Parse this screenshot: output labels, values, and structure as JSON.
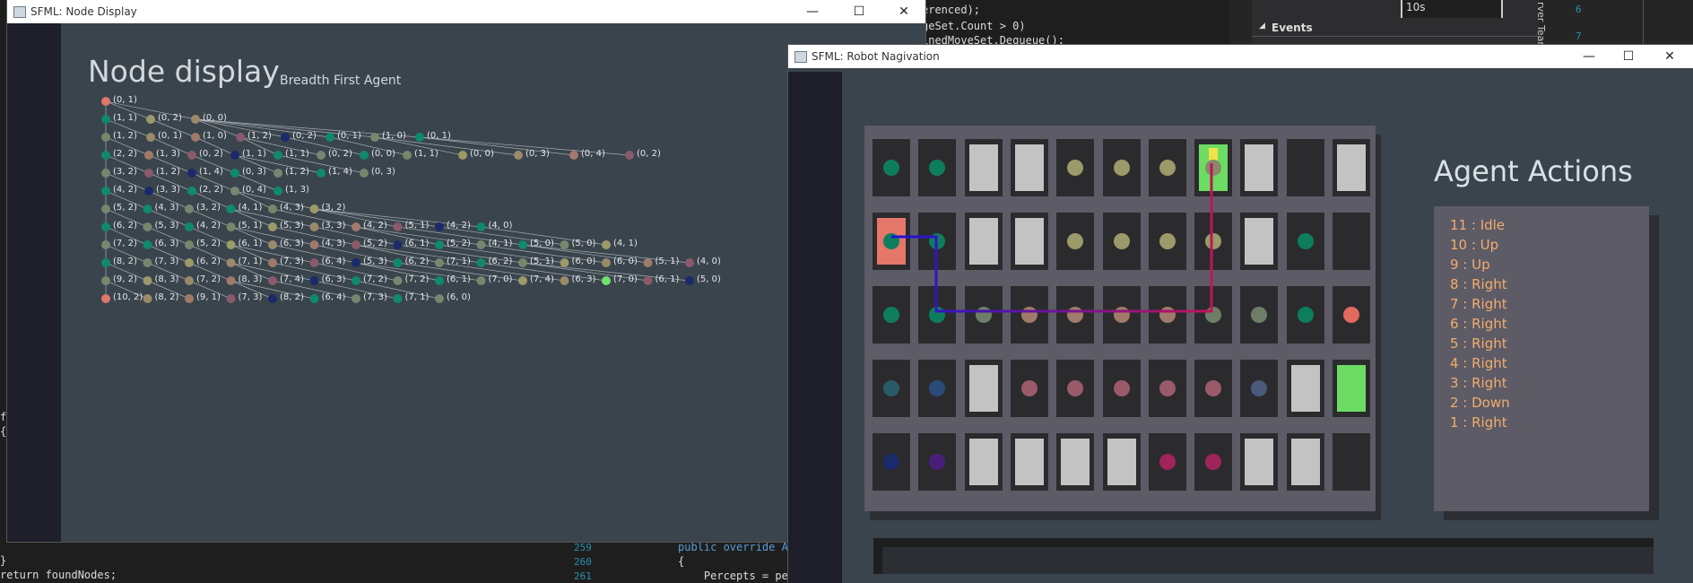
{
  "ide": {
    "code_top_1": "geSet.Count > 0)",
    "code_top_2": "inedMoveSet.Dequeue();",
    "code_top_0": "erenced);",
    "events_label": "Events",
    "timeline_label": "10s",
    "line_6": "6",
    "line_7": "7",
    "side_team": "Team",
    "side_ver": "rver",
    "line_259": "259",
    "line_260": "260",
    "line_261": "261",
    "code_259": "public override Ag",
    "code_260": "{",
    "code_261": "    Percepts = per",
    "code_return": "return foundNodes;",
    "code_brace": "}",
    "code_f": "f",
    "code_lbrace": "{"
  },
  "node_window": {
    "title": "SFML: Node Display",
    "heading": "Node display",
    "subheading": "Breadth First Agent"
  },
  "robot_window": {
    "title": "SFML: Robot Nagivation"
  },
  "window_buttons": {
    "minimize": "—",
    "maximize": "☐",
    "close": "✕"
  },
  "agent_actions": {
    "title": "Agent Actions",
    "items": [
      "11 : Idle",
      "10 : Up",
      "9 : Up",
      "8 : Right",
      "7 : Right",
      "6 : Right",
      "5 : Right",
      "4 : Right",
      "3 : Right",
      "2 : Down",
      "1 : Right"
    ]
  },
  "node_labels": [
    [
      "(0, 1)"
    ],
    [
      "(1, 1)",
      "(0, 2)",
      "(0, 0)"
    ],
    [
      "(1, 2)",
      "(0, 1)",
      "(1, 0)",
      "(1, 2)",
      "(0, 2)",
      "(0, 1)",
      "(1, 0)",
      "(0, 1)"
    ],
    [
      "(2, 2)",
      "(1, 3)",
      "(0, 2)",
      "(1, 1)",
      "(1, 1)",
      "(0, 2)",
      "(0, 0)",
      "(1, 1)",
      "(0, 0)",
      "(0, 3)",
      "(0, 4)",
      "(0, 2)"
    ],
    [
      "(3, 2)",
      "(1, 2)",
      "(1, 4)",
      "(0, 3)",
      "(1, 2)",
      "(1, 4)",
      "(0, 3)"
    ],
    [
      "(4, 2)",
      "(3, 3)",
      "(2, 2)",
      "(0, 4)",
      "(1, 3)"
    ],
    [
      "(5, 2)",
      "(4, 3)",
      "(3, 2)",
      "(4, 1)",
      "(4, 3)",
      "(3, 2)"
    ],
    [
      "(6, 2)",
      "(5, 3)",
      "(4, 2)",
      "(5, 1)",
      "(5, 3)",
      "(3, 3)",
      "(4, 2)",
      "(5, 1)",
      "(4, 2)",
      "(4, 0)"
    ],
    [
      "(7, 2)",
      "(6, 3)",
      "(5, 2)",
      "(6, 1)",
      "(6, 3)",
      "(4, 3)",
      "(5, 2)",
      "(6, 1)",
      "(5, 2)",
      "(4, 1)",
      "(5, 0)",
      "(5, 0)",
      "(4, 1)"
    ],
    [
      "(8, 2)",
      "(7, 3)",
      "(6, 2)",
      "(7, 1)",
      "(7, 3)",
      "(6, 4)",
      "(5, 3)",
      "(6, 2)",
      "(7, 1)",
      "(6, 2)",
      "(5, 1)",
      "(6, 0)",
      "(6, 0)",
      "(5, 1)",
      "(4, 0)"
    ],
    [
      "(9, 2)",
      "(8, 3)",
      "(7, 2)",
      "(8, 3)",
      "(7, 4)",
      "(6, 3)",
      "(7, 2)",
      "(7, 2)",
      "(6, 1)",
      "(7, 0)",
      "(7, 4)",
      "(6, 3)",
      "(7, 0)",
      "(6, 1)",
      "(5, 0)"
    ],
    [
      "(10, 2)",
      "(8, 2)",
      "(9, 1)",
      "(7, 3)",
      "(8, 2)",
      "(6, 4)",
      "(7, 3)",
      "(7, 1)",
      "(6, 0)"
    ]
  ],
  "node_colors": {
    "root": "#e0766c",
    "teal": "#0f8a6a",
    "sage": "#77876e",
    "olive": "#9a9a6a",
    "tan": "#9a8a6a",
    "brown": "#a07a6a",
    "mauve": "#8a5a6a",
    "navy": "#1a2a6a",
    "green_highlight": "#6ee36a"
  },
  "grid_colors": {
    "panel": "#5d5b66",
    "cell": "#2b2b2e",
    "wall": "#c3c3c3",
    "start": "#e4766a",
    "goal": "#6ddc62",
    "path_start": "#1a14d6",
    "path_end": "#c0145a"
  }
}
